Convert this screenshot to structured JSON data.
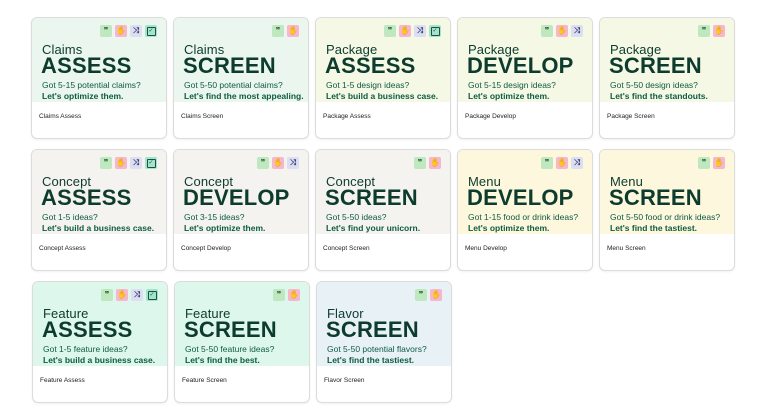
{
  "colors": {
    "mint": "#eaf6ee",
    "lime": "#f4f8e4",
    "beige": "#f4f3ef",
    "cream": "#fcf7dd",
    "teal": "#ddf7ed",
    "blue": "#e7f1f6"
  },
  "cards": [
    {
      "subtitle": "Claims",
      "title": "ASSESS",
      "line1": "Got 5-15 potential claims?",
      "line2": "Let's optimize them.",
      "name": "Claims Assess",
      "icons": [
        "quote-icon",
        "hand-icon",
        "shuffle-icon",
        "check-icon"
      ]
    },
    {
      "subtitle": "Claims",
      "title": "SCREEN",
      "line1": "Got 5-50 potential claims?",
      "line2": "Let's find the most appealing.",
      "name": "Claims Screen",
      "icons": [
        "quote-icon",
        "hand-icon"
      ]
    },
    {
      "subtitle": "Package",
      "title": "ASSESS",
      "line1": "Got 1-5 design ideas?",
      "line2": "Let's build a business case.",
      "name": "Package Assess",
      "icons": [
        "quote-icon",
        "hand-icon",
        "shuffle-icon",
        "check-icon"
      ]
    },
    {
      "subtitle": "Package",
      "title": "DEVELOP",
      "line1": "Got 5-15 design ideas?",
      "line2": "Let's optimize them.",
      "name": "Package Develop",
      "icons": [
        "quote-icon",
        "hand-icon",
        "shuffle-icon"
      ]
    },
    {
      "subtitle": "Package",
      "title": "SCREEN",
      "line1": "Got 5-50 design ideas?",
      "line2": "Let's find the standouts.",
      "name": "Package Screen",
      "icons": [
        "quote-icon",
        "hand-icon"
      ]
    },
    {
      "subtitle": "Concept",
      "title": "ASSESS",
      "line1": "Got 1-5 ideas?",
      "line2": "Let's build a business case.",
      "name": "Concept Assess",
      "icons": [
        "quote-icon",
        "hand-icon",
        "shuffle-icon",
        "check-icon"
      ]
    },
    {
      "subtitle": "Concept",
      "title": "DEVELOP",
      "line1": "Got 3-15 ideas?",
      "line2": "Let's optimize them.",
      "name": "Concept Develop",
      "icons": [
        "quote-icon",
        "hand-icon",
        "shuffle-icon"
      ]
    },
    {
      "subtitle": "Concept",
      "title": "SCREEN",
      "line1": "Got 5-50 ideas?",
      "line2": "Let's find your unicorn.",
      "name": "Concept Screen",
      "icons": [
        "quote-icon",
        "hand-icon"
      ]
    },
    {
      "subtitle": "Menu",
      "title": "DEVELOP",
      "line1": "Got 1-15 food or drink ideas?",
      "line2": "Let's optimize them.",
      "name": "Menu Develop",
      "icons": [
        "quote-icon",
        "hand-icon",
        "shuffle-icon"
      ]
    },
    {
      "subtitle": "Menu",
      "title": "SCREEN",
      "line1": "Got 5-50 food or drink ideas?",
      "line2": "Let's find the tastiest.",
      "name": "Menu Screen",
      "icons": [
        "quote-icon",
        "hand-icon"
      ]
    },
    {
      "subtitle": "Feature",
      "title": "ASSESS",
      "line1": "Got 1-5 feature ideas?",
      "line2": "Let's build a business case.",
      "name": "Feature Assess",
      "icons": [
        "quote-icon",
        "hand-icon",
        "shuffle-icon",
        "check-icon"
      ]
    },
    {
      "subtitle": "Feature",
      "title": "SCREEN",
      "line1": "Got 5-50 feature ideas?",
      "line2": "Let's find the best.",
      "name": "Feature Screen",
      "icons": [
        "quote-icon",
        "hand-icon"
      ]
    },
    {
      "subtitle": "Flavor",
      "title": "SCREEN",
      "line1": "Got 5-50 potential flavors?",
      "line2": "Let's find the tastiest.",
      "name": "Flavor Screen",
      "icons": [
        "quote-icon",
        "hand-icon"
      ]
    }
  ]
}
